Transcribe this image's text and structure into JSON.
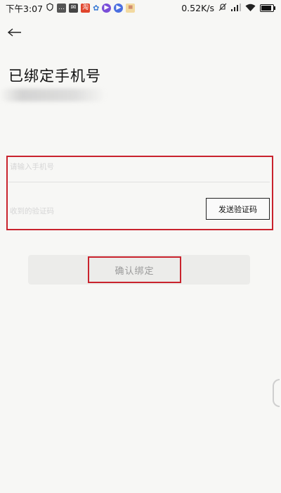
{
  "status_bar": {
    "time": "下午3:07",
    "network_speed": "0.52K/s",
    "battery_level": 0.85,
    "notification_icons": [
      "shield-icon",
      "message-icon",
      "mail-icon",
      "taobao-icon",
      "pinwheel-icon",
      "video-icon",
      "play-icon",
      "app-icon"
    ]
  },
  "header": {
    "title": "已绑定手机号"
  },
  "form": {
    "phone_placeholder": "请输入手机号",
    "phone_value": "",
    "code_placeholder": "收到的验证码",
    "code_value": "",
    "send_code_label": "发送验证码"
  },
  "confirm_label": "确认绑定",
  "colors": {
    "highlight_red": "#c9232d",
    "background": "#f7f7f5",
    "button_gray": "#ececea"
  }
}
